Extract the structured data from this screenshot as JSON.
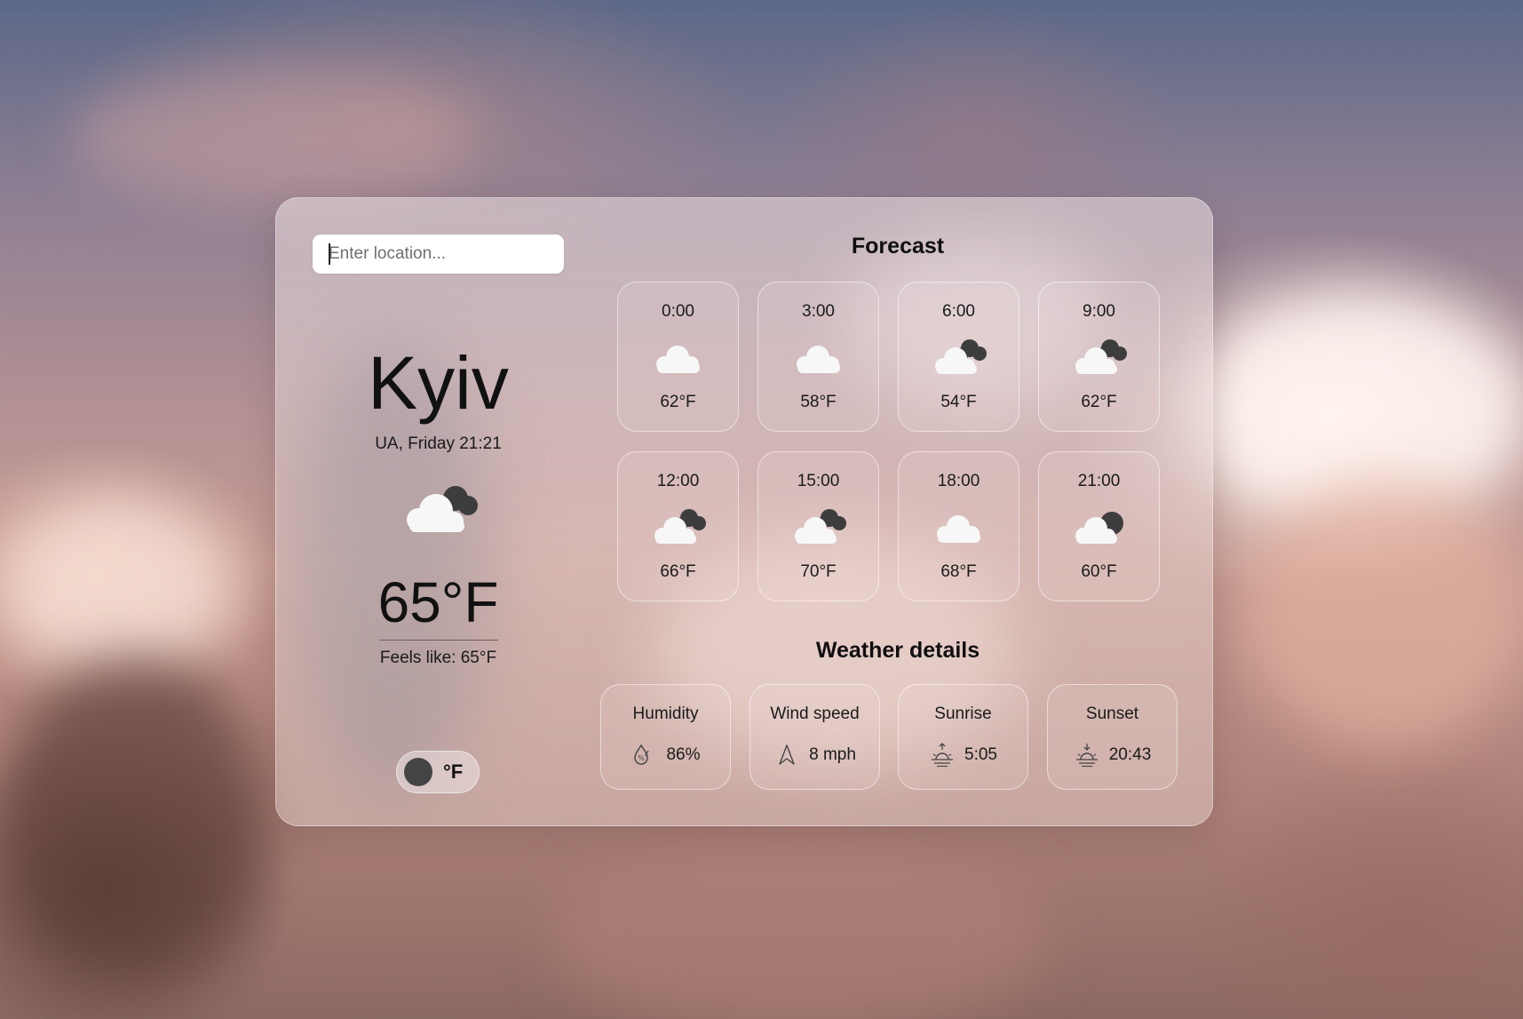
{
  "search": {
    "placeholder": "Enter location..."
  },
  "current": {
    "city": "Kyiv",
    "subline": "UA, Friday 21:21",
    "icon": "cloud-with-dark-clouds-icon",
    "temperature": "65°F",
    "feels_like": "Feels like: 65°F"
  },
  "unit_toggle": {
    "label": "°F"
  },
  "forecast": {
    "title": "Forecast",
    "items": [
      {
        "time": "0:00",
        "temp": "62°F",
        "icon": "cloud-icon"
      },
      {
        "time": "3:00",
        "temp": "58°F",
        "icon": "cloud-icon"
      },
      {
        "time": "6:00",
        "temp": "54°F",
        "icon": "cloudy-icon"
      },
      {
        "time": "9:00",
        "temp": "62°F",
        "icon": "cloudy-icon"
      },
      {
        "time": "12:00",
        "temp": "66°F",
        "icon": "cloudy-icon"
      },
      {
        "time": "15:00",
        "temp": "70°F",
        "icon": "cloudy-icon"
      },
      {
        "time": "18:00",
        "temp": "68°F",
        "icon": "cloud-icon"
      },
      {
        "time": "21:00",
        "temp": "60°F",
        "icon": "cloud-moon-icon"
      }
    ]
  },
  "details": {
    "title": "Weather details",
    "items": [
      {
        "label": "Humidity",
        "value": "86%",
        "icon": "humidity-icon"
      },
      {
        "label": "Wind speed",
        "value": "8 mph",
        "icon": "wind-arrow-icon"
      },
      {
        "label": "Sunrise",
        "value": "5:05",
        "icon": "sunrise-icon"
      },
      {
        "label": "Sunset",
        "value": "20:43",
        "icon": "sunset-icon"
      }
    ]
  }
}
